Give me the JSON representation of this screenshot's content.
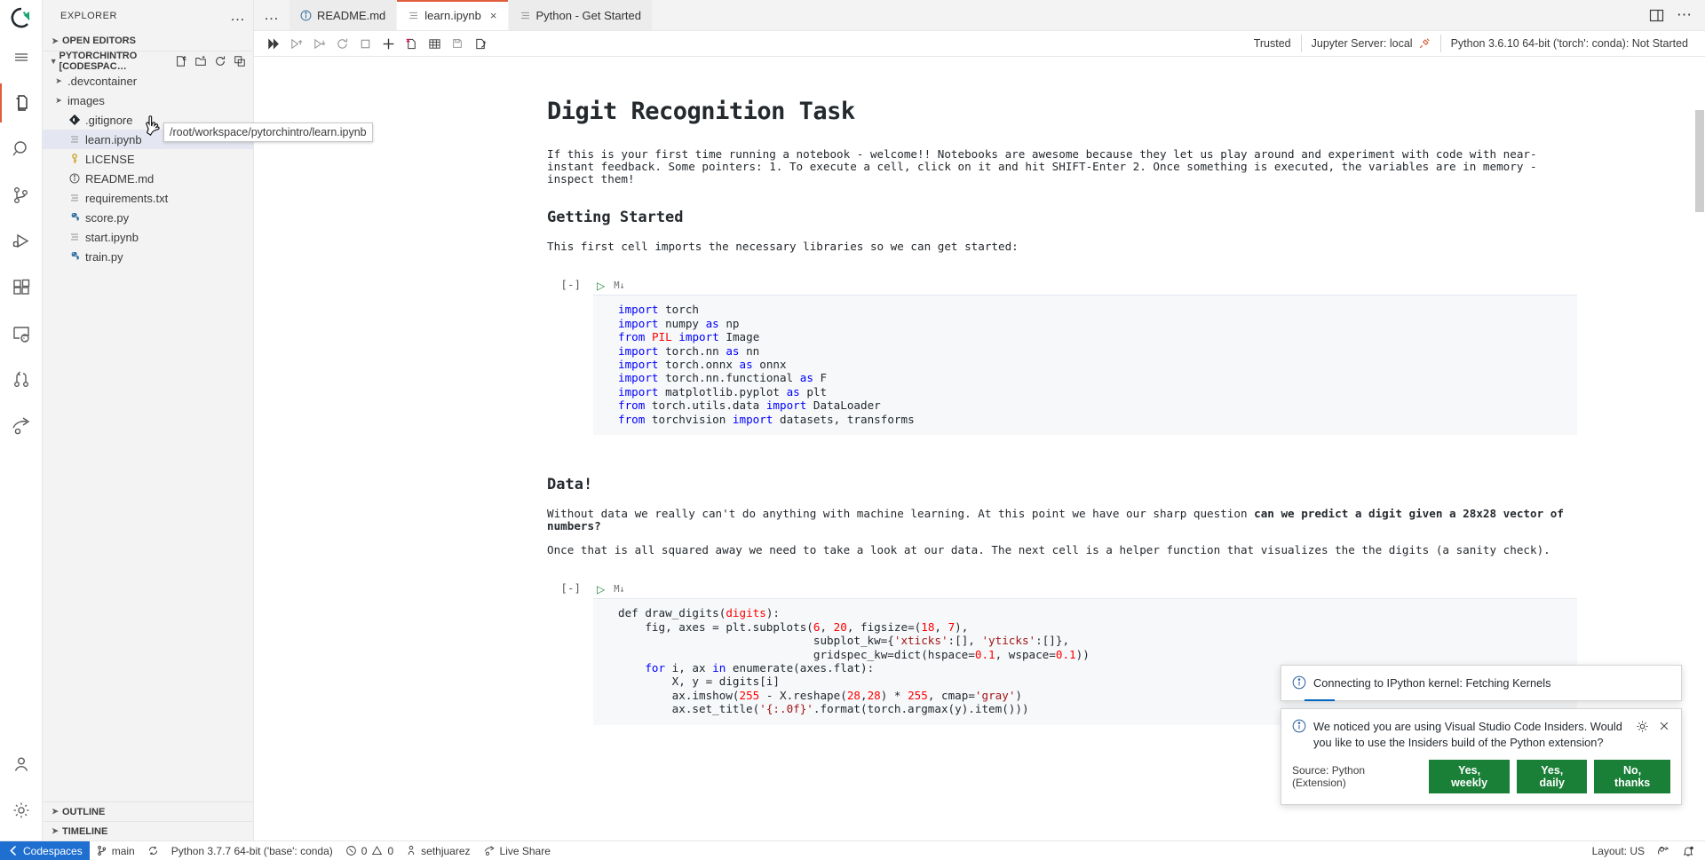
{
  "window": {
    "activitybar": {
      "logo": "vscode-codespaces-logo",
      "items": [
        {
          "name": "menu",
          "icon": "hamburger-icon",
          "active": false
        },
        {
          "name": "explorer",
          "icon": "files-icon",
          "active": true
        },
        {
          "name": "search",
          "icon": "search-icon",
          "active": false
        },
        {
          "name": "source-control",
          "icon": "source-control-icon",
          "active": false
        },
        {
          "name": "run-and-debug",
          "icon": "run-debug-icon",
          "active": false
        },
        {
          "name": "extensions",
          "icon": "extensions-icon",
          "active": false
        },
        {
          "name": "remote-explorer",
          "icon": "remote-explorer-icon",
          "active": false
        },
        {
          "name": "pull-requests",
          "icon": "pull-request-icon",
          "active": false
        },
        {
          "name": "live-share",
          "icon": "live-share-icon",
          "active": false
        }
      ],
      "bottom": [
        {
          "name": "accounts",
          "icon": "account-icon"
        },
        {
          "name": "settings",
          "icon": "gear-icon"
        }
      ]
    },
    "sidebar": {
      "title": "EXPLORER",
      "more_actions": "…",
      "sections": [
        {
          "label": "OPEN EDITORS",
          "expanded": false
        },
        {
          "label": "PYTORCHINTRO [CODESPAC…",
          "expanded": true
        }
      ],
      "header_actions": [
        "new-file-icon",
        "new-folder-icon",
        "refresh-icon",
        "collapse-all-icon"
      ],
      "files": [
        {
          "name": ".devcontainer",
          "type": "folder",
          "icon": "folder-icon",
          "expanded": false,
          "selected": false
        },
        {
          "name": "images",
          "type": "folder",
          "icon": "folder-icon",
          "expanded": false,
          "selected": false
        },
        {
          "name": ".gitignore",
          "type": "file",
          "icon": "git-icon",
          "selected": false
        },
        {
          "name": "learn.ipynb",
          "type": "file",
          "icon": "notebook-icon",
          "selected": true
        },
        {
          "name": "LICENSE",
          "type": "file",
          "icon": "key-icon",
          "selected": false
        },
        {
          "name": "README.md",
          "type": "file",
          "icon": "info-icon",
          "selected": false
        },
        {
          "name": "requirements.txt",
          "type": "file",
          "icon": "text-icon",
          "selected": false
        },
        {
          "name": "score.py",
          "type": "file",
          "icon": "python-icon",
          "selected": false
        },
        {
          "name": "start.ipynb",
          "type": "file",
          "icon": "notebook-icon",
          "selected": false
        },
        {
          "name": "train.py",
          "type": "file",
          "icon": "python-icon",
          "selected": false
        }
      ],
      "bottom_sections": [
        {
          "label": "OUTLINE",
          "expanded": false
        },
        {
          "label": "TIMELINE",
          "expanded": false
        }
      ]
    },
    "tooltip": {
      "text": "/root/workspace/pytorchintro/learn.ipynb",
      "cursor": "hand-pointer-cursor"
    },
    "tabs": {
      "more": "…",
      "items": [
        {
          "label": "README.md",
          "icon": "info-icon",
          "active": false,
          "closable": false
        },
        {
          "label": "learn.ipynb",
          "icon": "notebook-icon",
          "active": true,
          "closable": true,
          "close": "×"
        },
        {
          "label": "Python - Get Started",
          "icon": "text-icon",
          "active": false,
          "closable": false
        }
      ],
      "right_actions": [
        "split-editor-icon",
        "more-actions-icon"
      ]
    },
    "notebook_toolbar": {
      "buttons": [
        {
          "name": "run-all-cells",
          "icon": "run-all-icon"
        },
        {
          "name": "run-above-cells",
          "icon": "run-above-icon"
        },
        {
          "name": "run-below-cells",
          "icon": "run-below-icon"
        },
        {
          "name": "restart-kernel",
          "icon": "restart-icon"
        },
        {
          "name": "interrupt-kernel",
          "icon": "stop-square-icon"
        },
        {
          "name": "add-cell",
          "icon": "plus-icon"
        },
        {
          "name": "clear-outputs",
          "icon": "clear-outputs-icon"
        },
        {
          "name": "variables",
          "icon": "variables-grid-icon"
        },
        {
          "name": "save-notebook",
          "icon": "save-icon"
        },
        {
          "name": "export-notebook",
          "icon": "export-icon"
        }
      ],
      "status": [
        {
          "name": "trusted",
          "label": "Trusted",
          "icon": null
        },
        {
          "name": "jupyter-server",
          "label": "Jupyter Server: local",
          "icon": "plug-icon"
        },
        {
          "name": "kernel-selector",
          "label": "Python 3.6.10 64-bit ('torch': conda): Not Started",
          "icon": null
        }
      ]
    },
    "notebook": {
      "cells": [
        {
          "type": "markdown",
          "blocks": [
            {
              "kind": "h1",
              "text": "Digit Recognition Task"
            },
            {
              "kind": "p",
              "text": "If this is your first time running a notebook - welcome!! Notebooks are awesome because they let us play around and experiment with code with near-instant feedback. Some pointers: 1. To execute a cell, click on it and hit SHIFT-Enter 2. Once something is executed, the variables are in memory - inspect them!"
            },
            {
              "kind": "h2",
              "text": "Getting Started"
            },
            {
              "kind": "p",
              "text": "This first cell imports the necessary libraries so we can get started:"
            }
          ]
        },
        {
          "type": "code",
          "execution_count": "[-]",
          "run_icon": "run-cell-play-icon",
          "language": "M↓",
          "lines": [
            [
              {
                "t": "import",
                "c": "kw"
              },
              {
                "t": " torch",
                "c": ""
              }
            ],
            [
              {
                "t": "import",
                "c": "kw"
              },
              {
                "t": " numpy ",
                "c": ""
              },
              {
                "t": "as",
                "c": "kw"
              },
              {
                "t": " np",
                "c": ""
              }
            ],
            [
              {
                "t": "from",
                "c": "kw"
              },
              {
                "t": " ",
                "c": ""
              },
              {
                "t": "PIL",
                "c": "cls"
              },
              {
                "t": " ",
                "c": ""
              },
              {
                "t": "import",
                "c": "kw"
              },
              {
                "t": " Image",
                "c": ""
              }
            ],
            [
              {
                "t": "import",
                "c": "kw"
              },
              {
                "t": " torch.nn ",
                "c": ""
              },
              {
                "t": "as",
                "c": "kw"
              },
              {
                "t": " nn",
                "c": ""
              }
            ],
            [
              {
                "t": "import",
                "c": "kw"
              },
              {
                "t": " torch.onnx ",
                "c": ""
              },
              {
                "t": "as",
                "c": "kw"
              },
              {
                "t": " onnx",
                "c": ""
              }
            ],
            [
              {
                "t": "import",
                "c": "kw"
              },
              {
                "t": " torch.nn.functional ",
                "c": ""
              },
              {
                "t": "as",
                "c": "kw"
              },
              {
                "t": " F",
                "c": ""
              }
            ],
            [
              {
                "t": "import",
                "c": "kw"
              },
              {
                "t": " matplotlib.pyplot ",
                "c": ""
              },
              {
                "t": "as",
                "c": "kw"
              },
              {
                "t": " plt",
                "c": ""
              }
            ],
            [
              {
                "t": "from",
                "c": "kw"
              },
              {
                "t": " torch.utils.data ",
                "c": ""
              },
              {
                "t": "import",
                "c": "kw"
              },
              {
                "t": " DataLoader",
                "c": ""
              }
            ],
            [
              {
                "t": "from",
                "c": "kw"
              },
              {
                "t": " torchvision ",
                "c": ""
              },
              {
                "t": "import",
                "c": "kw"
              },
              {
                "t": " datasets, transforms",
                "c": ""
              }
            ]
          ]
        },
        {
          "type": "markdown",
          "blocks": [
            {
              "kind": "h2",
              "text": "Data!"
            },
            {
              "kind": "p_html",
              "text": "Without data we really can't do anything with machine learning. At this point we have our sharp question <b>can we predict a digit given a 28x28 vector of numbers?</b>"
            },
            {
              "kind": "p",
              "text": "Once that is all squared away we need to take a look at our data. The next cell is a helper function that visualizes the the digits (a sanity check)."
            }
          ]
        },
        {
          "type": "code",
          "execution_count": "[-]",
          "run_icon": "run-cell-play-icon",
          "language": "M↓",
          "lines": [
            [
              {
                "t": "def draw_digits(",
                "c": ""
              },
              {
                "t": "digits",
                "c": "cls"
              },
              {
                "t": "):",
                "c": ""
              }
            ],
            [
              {
                "t": "    fig, axes = plt.subplots(",
                "c": ""
              },
              {
                "t": "6",
                "c": "num"
              },
              {
                "t": ", ",
                "c": ""
              },
              {
                "t": "20",
                "c": "num"
              },
              {
                "t": ", figsize=(",
                "c": ""
              },
              {
                "t": "18",
                "c": "num"
              },
              {
                "t": ", ",
                "c": ""
              },
              {
                "t": "7",
                "c": "num"
              },
              {
                "t": "),",
                "c": ""
              }
            ],
            [
              {
                "t": "                          subplot_kw={",
                "c": ""
              },
              {
                "t": "'xticks'",
                "c": "str"
              },
              {
                "t": ":[], ",
                "c": ""
              },
              {
                "t": "'yticks'",
                "c": "str"
              },
              {
                "t": ":[]},",
                "c": ""
              }
            ],
            [
              {
                "t": "                          gridspec_kw=dict(hspace=",
                "c": ""
              },
              {
                "t": "0.1",
                "c": "num"
              },
              {
                "t": ", wspace=",
                "c": ""
              },
              {
                "t": "0.1",
                "c": "num"
              },
              {
                "t": "))",
                "c": ""
              }
            ],
            [
              {
                "t": "    ",
                "c": ""
              },
              {
                "t": "for",
                "c": "kw"
              },
              {
                "t": " i, ax ",
                "c": ""
              },
              {
                "t": "in",
                "c": "kw"
              },
              {
                "t": " enumerate(axes.flat):",
                "c": ""
              }
            ],
            [
              {
                "t": "        X, y = digits[i]",
                "c": ""
              }
            ],
            [
              {
                "t": "        ax.imshow(",
                "c": ""
              },
              {
                "t": "255",
                "c": "num"
              },
              {
                "t": " - X.reshape(",
                "c": ""
              },
              {
                "t": "28",
                "c": "num"
              },
              {
                "t": ",",
                "c": ""
              },
              {
                "t": "28",
                "c": "num"
              },
              {
                "t": ") * ",
                "c": ""
              },
              {
                "t": "255",
                "c": "num"
              },
              {
                "t": ", cmap=",
                "c": ""
              },
              {
                "t": "'gray'",
                "c": "str"
              },
              {
                "t": ")",
                "c": ""
              }
            ],
            [
              {
                "t": "        ax.set_title(",
                "c": ""
              },
              {
                "t": "'{:.0f}'",
                "c": "str"
              },
              {
                "t": ".format(torch.argmax(y).item()))",
                "c": ""
              }
            ]
          ]
        }
      ]
    },
    "notifications": [
      {
        "id": "kernel-connect",
        "icon": "info-circle-icon",
        "message": "Connecting to IPython kernel: Fetching Kernels",
        "progress": true,
        "actions": [],
        "icon_actions": []
      },
      {
        "id": "python-insiders",
        "icon": "info-circle-icon",
        "message": "We noticed you are using Visual Studio Code Insiders. Would you like to use the Insiders build of the Python extension?",
        "source": "Source: Python (Extension)",
        "icon_actions": [
          "gear-icon",
          "close-icon"
        ],
        "actions": [
          {
            "label": "Yes, weekly",
            "style": "green"
          },
          {
            "label": "Yes, daily",
            "style": "green"
          },
          {
            "label": "No, thanks",
            "style": "green"
          }
        ]
      }
    ],
    "statusbar": {
      "remote": {
        "label": "Codespaces",
        "icon": "remote-icon",
        "color": "#1f6fd0"
      },
      "left": [
        {
          "name": "git-branch",
          "label": "main",
          "icon": "branch-icon"
        },
        {
          "name": "sync-changes",
          "label": "",
          "icon": "sync-icon"
        },
        {
          "name": "python-interpreter",
          "label": "Python 3.7.7 64-bit ('base': conda)",
          "icon": null
        },
        {
          "name": "problems",
          "label": "0  0",
          "icon": "error-warning-icon"
        },
        {
          "name": "account-user",
          "label": "sethjuarez",
          "icon": "person-icon"
        },
        {
          "name": "live-share",
          "label": "Live Share",
          "icon": "live-share-icon"
        }
      ],
      "right": [
        {
          "name": "keyboard-layout",
          "label": "Layout: US",
          "icon": null
        },
        {
          "name": "feedback",
          "label": "",
          "icon": "feedback-smiley-icon"
        },
        {
          "name": "notifications",
          "label": "",
          "icon": "bell-dot-icon"
        }
      ]
    },
    "colors": {
      "accent_tab": "#e05c3b",
      "remote_bar": "#1f6fd0",
      "button_green": "#1a7f37",
      "keyword_blue": "#0000ff",
      "string_red": "#a31515",
      "number_red": "#ff0000"
    }
  }
}
